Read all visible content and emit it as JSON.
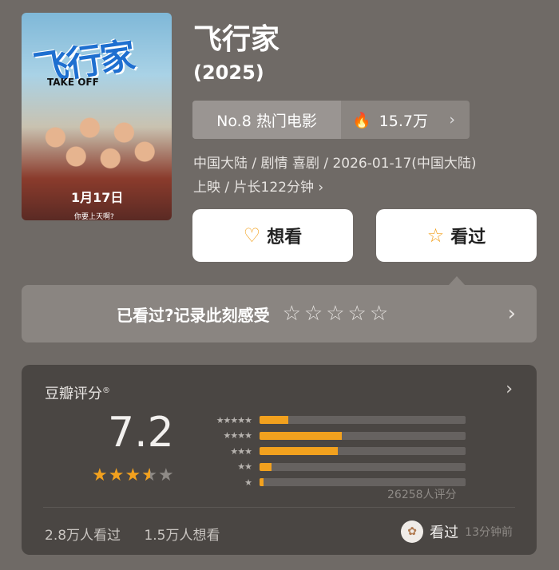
{
  "movie": {
    "title": "飞行家",
    "year": "(2025)",
    "poster": {
      "title_art": "飞行家",
      "subtitle_art": "TAKE OFF",
      "date_art": "1月17日",
      "tagline_art": "你要上天啊?"
    },
    "rank_label": "No.8 热门电影",
    "heat_value": "15.7万",
    "meta_line1": "中国大陆 / 剧情 喜剧 / 2026-01-17(中国大陆)",
    "meta_line2": "上映 / 片长122分钟 ›"
  },
  "actions": {
    "want_label": "想看",
    "seen_label": "看过"
  },
  "record_prompt": "已看过?记录此刻感受",
  "rating": {
    "title": "豆瓣评分",
    "score": "7.2",
    "stars_value": 3.5,
    "distribution_pct": [
      {
        "stars": 5,
        "pct": 14
      },
      {
        "stars": 4,
        "pct": 40
      },
      {
        "stars": 3,
        "pct": 38
      },
      {
        "stars": 2,
        "pct": 6
      },
      {
        "stars": 1,
        "pct": 2
      }
    ],
    "votes_text": "26258人评分",
    "seen_count": "2.8万人看过",
    "want_count": "1.5万人想看",
    "my_status": "看过",
    "my_time": "13分钟前"
  },
  "colors": {
    "accent": "#f2a11e"
  }
}
